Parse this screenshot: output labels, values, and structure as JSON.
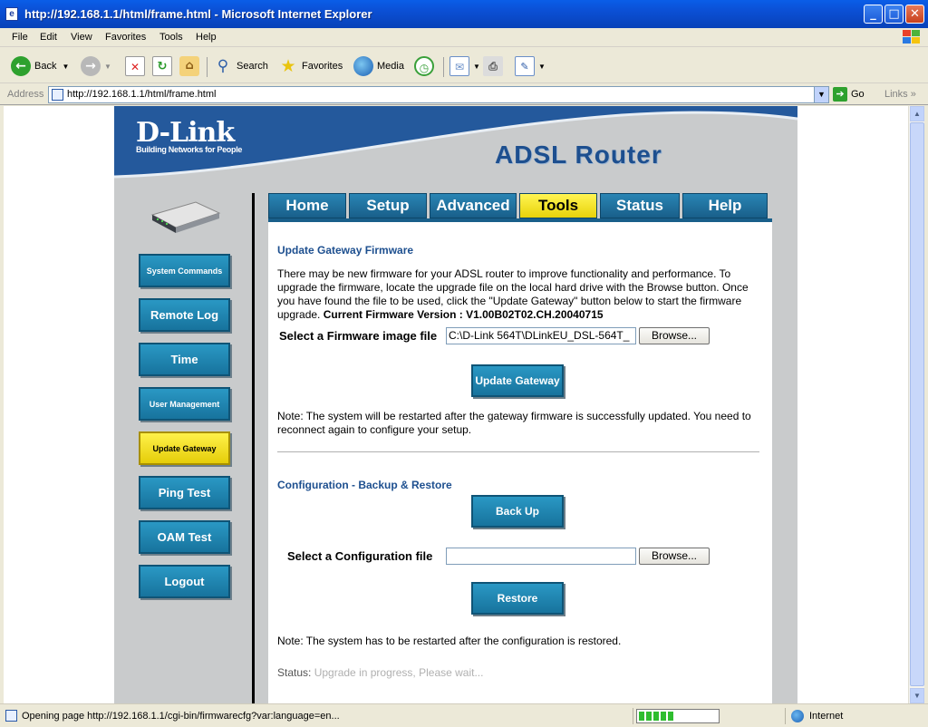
{
  "window": {
    "title": "http://192.168.1.1/html/frame.html - Microsoft Internet Explorer"
  },
  "menu": [
    "File",
    "Edit",
    "View",
    "Favorites",
    "Tools",
    "Help"
  ],
  "toolbar": {
    "back": "Back",
    "search": "Search",
    "favorites": "Favorites",
    "media": "Media"
  },
  "address": {
    "label": "Address",
    "url": "http://192.168.1.1/html/frame.html",
    "go": "Go",
    "links": "Links"
  },
  "router": {
    "logo": "D-Link",
    "tagline": "Building Networks for People",
    "product": "ADSL Router",
    "sidebar": [
      {
        "label": "System Commands",
        "active": false
      },
      {
        "label": "Remote Log",
        "active": false
      },
      {
        "label": "Time",
        "active": false
      },
      {
        "label": "User Management",
        "active": false
      },
      {
        "label": "Update Gateway",
        "active": true
      },
      {
        "label": "Ping Test",
        "active": false
      },
      {
        "label": "OAM Test",
        "active": false
      },
      {
        "label": "Logout",
        "active": false
      }
    ],
    "tabs": [
      {
        "label": "Home",
        "active": false
      },
      {
        "label": "Setup",
        "active": false
      },
      {
        "label": "Advanced",
        "active": false
      },
      {
        "label": "Tools",
        "active": true
      },
      {
        "label": "Status",
        "active": false
      },
      {
        "label": "Help",
        "active": false
      }
    ],
    "firmware": {
      "title": "Update Gateway Firmware",
      "description": "There may be new firmware for your ADSL router to improve functionality and performance. To upgrade the firmware, locate the upgrade file on the local hard drive with the Browse button. Once you have found the file to be used, click the \"Update Gateway\" button below to start the firmware upgrade.",
      "version_label": "Current Firmware Version :",
      "version_value": "V1.00B02T02.CH.20040715",
      "file_label": "Select a Firmware image file",
      "file_value": "C:\\D-Link 564T\\DLinkEU_DSL-564T_",
      "browse": "Browse...",
      "update_button": "Update Gateway",
      "note": "Note: The system will be restarted after the gateway firmware is successfully updated. You need to reconnect again to configure your setup."
    },
    "config": {
      "title": "Configuration - Backup & Restore",
      "backup_button": "Back Up",
      "file_label": "Select a Configuration file",
      "file_value": "",
      "browse": "Browse...",
      "restore_button": "Restore",
      "note": "Note: The system has to be restarted after the configuration is restored.",
      "status_label": "Status:",
      "status_value": "Upgrade in progress, Please wait..."
    }
  },
  "statusbar": {
    "message": "Opening page http://192.168.1.1/cgi-bin/firmwarecfg?var:language=en...",
    "progress_fraction": 0.45,
    "zone": "Internet"
  }
}
